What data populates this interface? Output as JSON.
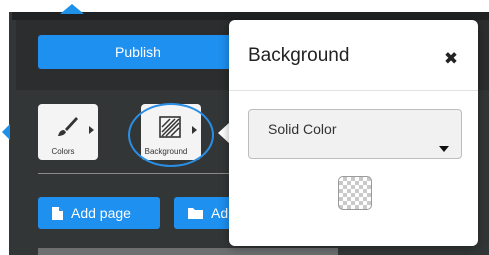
{
  "toolbar": {
    "publish_label": "Publish"
  },
  "tools": [
    {
      "label": "Colors",
      "icon": "paintbrush-icon"
    },
    {
      "label": "Background",
      "icon": "background-pattern-icon"
    }
  ],
  "actions": {
    "add_page_label": "Add page",
    "add_other_label": "Ad"
  },
  "popover": {
    "title": "Background",
    "close_icon": "close-icon",
    "select_value": "Solid Color",
    "swatch_icon": "transparent-swatch"
  },
  "colors": {
    "accent": "#1e90f0",
    "panel_dark": "#333637",
    "highlight_ring": "#2a8ee6"
  }
}
